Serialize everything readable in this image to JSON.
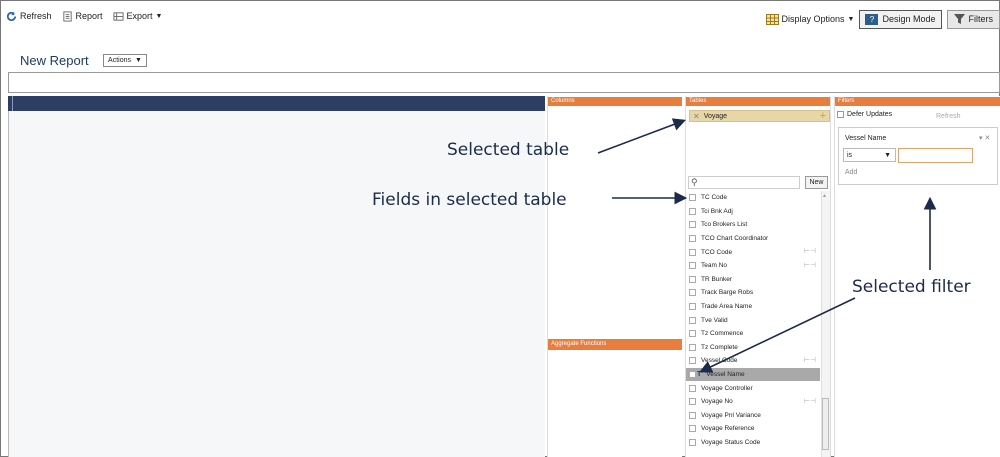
{
  "toolbar": {
    "refresh_label": "Refresh",
    "report_label": "Report",
    "export_label": "Export",
    "display_options_label": "Display Options",
    "design_mode_label": "Design Mode",
    "design_mode_icon_text": "?",
    "filters_label": "Filters"
  },
  "header": {
    "title": "New Report",
    "actions_label": "Actions"
  },
  "columns_panel": {
    "title": "Columns",
    "aggregate_title": "Aggregate Functions"
  },
  "tables_panel": {
    "title": "Tables",
    "selected_table": "Voyage",
    "new_button": "New",
    "fields": [
      {
        "name": "TC Code"
      },
      {
        "name": "Tci Bnk Adj"
      },
      {
        "name": "Tco Brokers List"
      },
      {
        "name": "TCO Chart Coordinator"
      },
      {
        "name": "TCO Code",
        "join": true
      },
      {
        "name": "Team No",
        "join": true
      },
      {
        "name": "TR Bunker"
      },
      {
        "name": "Track Barge Robs"
      },
      {
        "name": "Trade Area Name"
      },
      {
        "name": "Tve Valid"
      },
      {
        "name": "Tz Commence"
      },
      {
        "name": "Tz Complete"
      },
      {
        "name": "Vessel Code",
        "join": true
      },
      {
        "name": "Vessel Name",
        "selected": true
      },
      {
        "name": "Voyage Controller"
      },
      {
        "name": "Voyage No",
        "join": true
      },
      {
        "name": "Voyage Pnl Variance"
      },
      {
        "name": "Voyage Reference"
      },
      {
        "name": "Voyage Status Code"
      }
    ]
  },
  "filters_panel": {
    "title": "Filters",
    "defer_updates": "Defer Updates",
    "refresh": "Refresh",
    "filter_name": "Vessel Name",
    "filter_ctrl": "▾ ✕",
    "operator": "is",
    "add": "Add"
  },
  "annotations": {
    "selected_table": "Selected table",
    "fields_in_table": "Fields in selected table",
    "selected_filter": "Selected filter"
  },
  "colors": {
    "panel_header": "#e87e3e",
    "canvas_header": "#2c3f63",
    "selected_chip": "#e7d6a8",
    "design_mode": "#2f5d8a"
  }
}
